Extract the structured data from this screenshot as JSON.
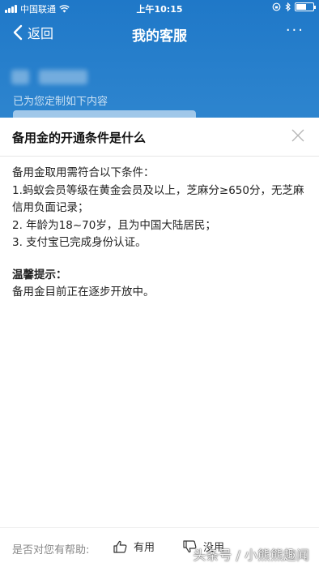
{
  "status_bar": {
    "carrier": "中国联通",
    "time": "上午10:15",
    "wifi_icon": "wifi-icon",
    "battery_icon": "battery-icon"
  },
  "nav": {
    "back_label": "返回",
    "title": "我的客服",
    "more_label": "···"
  },
  "background": {
    "greeting": "已为您定制如下内容"
  },
  "sheet": {
    "title": "备用金的开通条件是什么",
    "close_icon": "close-icon",
    "content": {
      "intro": "备用金取用需符合以下条件：",
      "items": [
        "1.蚂蚁会员等级在黄金会员及以上，芝麻分≥650分，无芝麻信用负面记录；",
        "2. 年龄为18~70岁，且为中国大陆居民；",
        "3. 支付宝已完成身份认证。"
      ],
      "tip_title": "温馨提示：",
      "tip_text": "备用金目前正在逐步开放中。"
    }
  },
  "feedback": {
    "question": "是否对您有帮助:",
    "useful_label": "有用",
    "useless_label": "没用"
  },
  "watermark": "头条号 / 小熊熊趣闻",
  "colors": {
    "header_blue": "#1f78c8",
    "text": "#222222"
  }
}
